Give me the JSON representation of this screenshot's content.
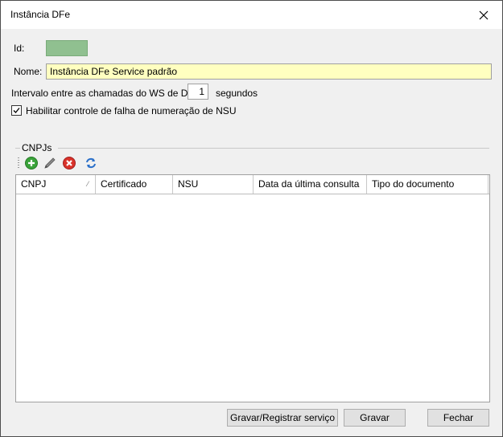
{
  "window": {
    "title": "Instância DFe"
  },
  "form": {
    "id_label": "Id:",
    "name_label": "Nome:",
    "name_value": "Instância DFe Service padrão",
    "interval_label": "Intervalo entre as chamadas do WS de DFe",
    "interval_value": "1",
    "interval_unit": "segundos",
    "nsu_check_label": "Habilitar controle de falha de numeração de NSU",
    "nsu_check_checked": true
  },
  "cnpjs": {
    "group_label": "CNPJs",
    "toolbar": [
      {
        "name": "add",
        "icon": "add-icon",
        "color": "#3aa33a"
      },
      {
        "name": "edit",
        "icon": "pencil-icon",
        "color": "#555555"
      },
      {
        "name": "delete",
        "icon": "delete-icon",
        "color": "#d9322a"
      },
      {
        "name": "refresh",
        "icon": "refresh-icon",
        "color": "#2a6fc9"
      }
    ],
    "columns": [
      "CNPJ",
      "Certificado",
      "NSU",
      "Data da última consulta",
      "Tipo do documento"
    ],
    "rows": []
  },
  "buttons": {
    "save_register": "Gravar/Registrar serviço",
    "save": "Gravar",
    "close": "Fechar"
  }
}
